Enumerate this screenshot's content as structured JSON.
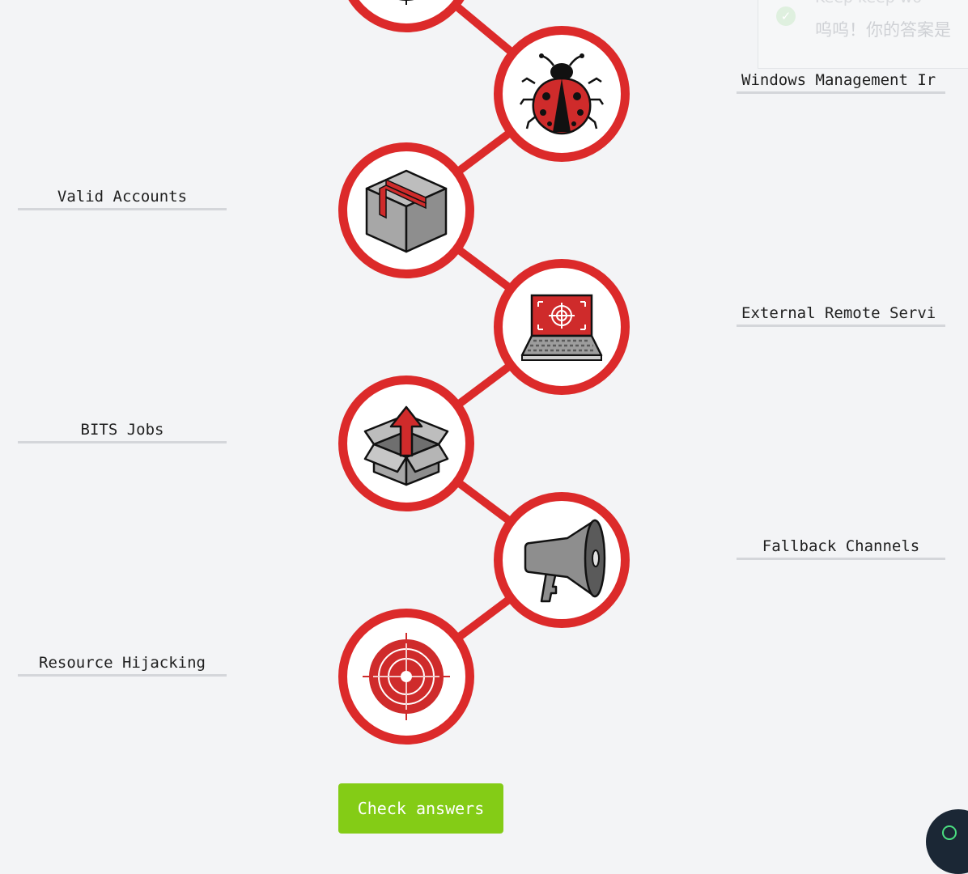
{
  "toast": {
    "title": "Keep keep wo",
    "message": "呜呜！你的答案是"
  },
  "chain": {
    "line_color": "#dc2a2a",
    "nodes": [
      {
        "icon": "crosshair-icon"
      },
      {
        "icon": "ladybug-icon"
      },
      {
        "icon": "box-icon"
      },
      {
        "icon": "laptop-target-icon"
      },
      {
        "icon": "open-box-arrow-icon"
      },
      {
        "icon": "megaphone-icon"
      },
      {
        "icon": "target-icon"
      }
    ]
  },
  "labels": {
    "windows_management": "Windows Management Ir",
    "valid_accounts": "Valid Accounts",
    "external_remote": "External Remote Servi",
    "bits_jobs": "BITS Jobs",
    "fallback_channels": "Fallback Channels",
    "resource_hijacking": "Resource Hijacking"
  },
  "check_button": {
    "label": "Check answers"
  },
  "colors": {
    "accent_red": "#dc2a2a",
    "button_green": "#84cc16",
    "background": "#f3f4f6",
    "chat_fab": "#1b2735"
  }
}
